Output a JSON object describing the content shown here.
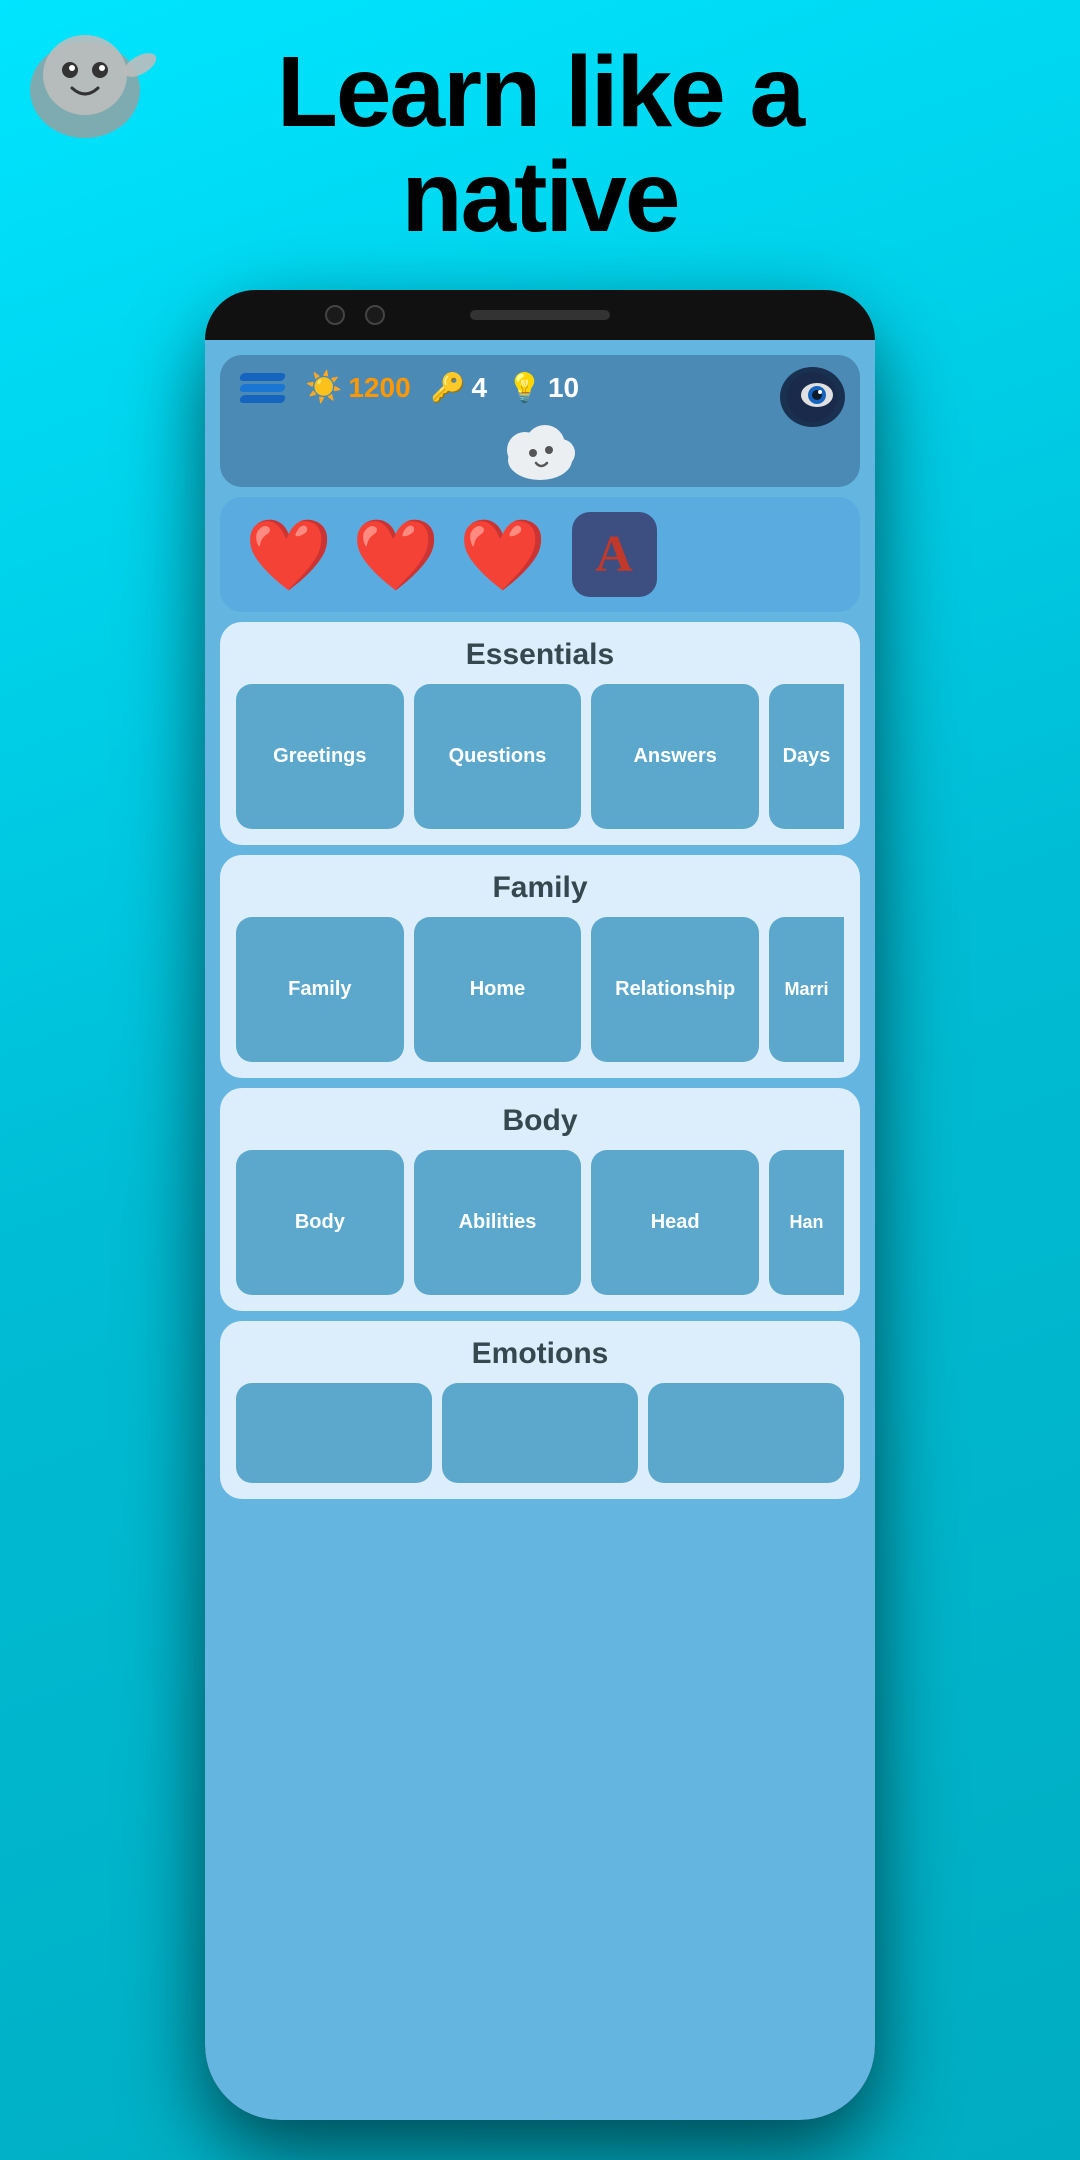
{
  "app": {
    "headline_line1": "Learn like a",
    "headline_line2": "native"
  },
  "header": {
    "coins": "1200",
    "keys": "4",
    "hints": "10"
  },
  "lives": {
    "hearts": [
      "❤️",
      "❤️",
      "❤️"
    ],
    "letter": "A"
  },
  "sections": [
    {
      "id": "essentials",
      "title": "Essentials",
      "topics": [
        "Greetings",
        "Questions",
        "Answers",
        "Days"
      ]
    },
    {
      "id": "family",
      "title": "Family",
      "topics": [
        "Family",
        "Home",
        "Relationship",
        "Marriage"
      ]
    },
    {
      "id": "body",
      "title": "Body",
      "topics": [
        "Body",
        "Abilities",
        "Head",
        "Hands"
      ]
    },
    {
      "id": "emotions",
      "title": "Emotions",
      "topics": []
    }
  ]
}
